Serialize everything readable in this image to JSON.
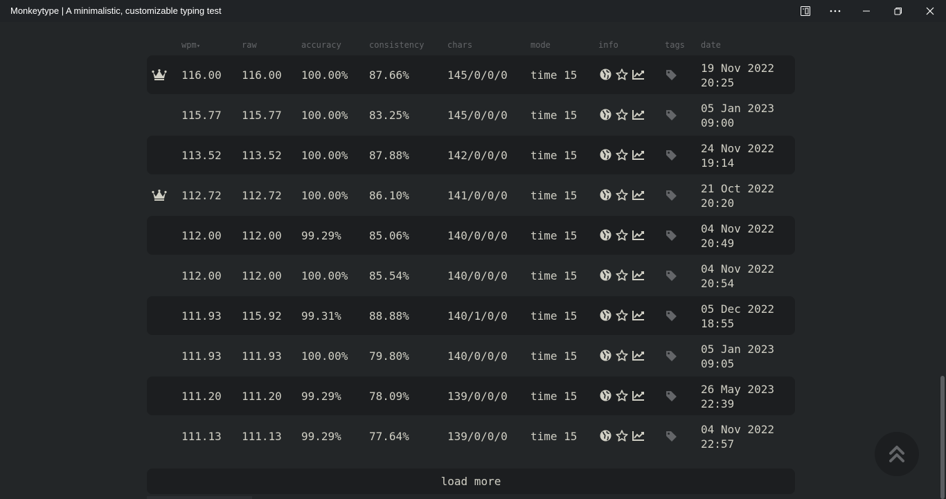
{
  "window": {
    "title": "Monkeytype | A minimalistic, customizable typing test"
  },
  "table": {
    "headers": {
      "wpm": "wpm",
      "raw": "raw",
      "accuracy": "accuracy",
      "consistency": "consistency",
      "chars": "chars",
      "mode": "mode",
      "info": "info",
      "tags": "tags",
      "date": "date"
    },
    "sort_indicator": "▾",
    "rows": [
      {
        "pb": true,
        "wpm": "116.00",
        "raw": "116.00",
        "accuracy": "100.00%",
        "consistency": "87.66%",
        "chars": "145/0/0/0",
        "mode": "time 15",
        "date": "19 Nov 2022",
        "time": "20:25"
      },
      {
        "pb": false,
        "wpm": "115.77",
        "raw": "115.77",
        "accuracy": "100.00%",
        "consistency": "83.25%",
        "chars": "145/0/0/0",
        "mode": "time 15",
        "date": "05 Jan 2023",
        "time": "09:00"
      },
      {
        "pb": false,
        "wpm": "113.52",
        "raw": "113.52",
        "accuracy": "100.00%",
        "consistency": "87.88%",
        "chars": "142/0/0/0",
        "mode": "time 15",
        "date": "24 Nov 2022",
        "time": "19:14"
      },
      {
        "pb": true,
        "wpm": "112.72",
        "raw": "112.72",
        "accuracy": "100.00%",
        "consistency": "86.10%",
        "chars": "141/0/0/0",
        "mode": "time 15",
        "date": "21 Oct 2022",
        "time": "20:20"
      },
      {
        "pb": false,
        "wpm": "112.00",
        "raw": "112.00",
        "accuracy": "99.29%",
        "consistency": "85.06%",
        "chars": "140/0/0/0",
        "mode": "time 15",
        "date": "04 Nov 2022",
        "time": "20:49"
      },
      {
        "pb": false,
        "wpm": "112.00",
        "raw": "112.00",
        "accuracy": "100.00%",
        "consistency": "85.54%",
        "chars": "140/0/0/0",
        "mode": "time 15",
        "date": "04 Nov 2022",
        "time": "20:54"
      },
      {
        "pb": false,
        "wpm": "111.93",
        "raw": "115.92",
        "accuracy": "99.31%",
        "consistency": "88.88%",
        "chars": "140/1/0/0",
        "mode": "time 15",
        "date": "05 Dec 2022",
        "time": "18:55"
      },
      {
        "pb": false,
        "wpm": "111.93",
        "raw": "111.93",
        "accuracy": "100.00%",
        "consistency": "79.80%",
        "chars": "140/0/0/0",
        "mode": "time 15",
        "date": "05 Jan 2023",
        "time": "09:05"
      },
      {
        "pb": false,
        "wpm": "111.20",
        "raw": "111.20",
        "accuracy": "99.29%",
        "consistency": "78.09%",
        "chars": "139/0/0/0",
        "mode": "time 15",
        "date": "26 May 2023",
        "time": "22:39"
      },
      {
        "pb": false,
        "wpm": "111.13",
        "raw": "111.13",
        "accuracy": "99.29%",
        "consistency": "77.64%",
        "chars": "139/0/0/0",
        "mode": "time 15",
        "date": "04 Nov 2022",
        "time": "22:57"
      }
    ]
  },
  "load_more_label": "load more",
  "icons": {
    "pb": "crown-icon",
    "info": [
      "globe-icon",
      "star-icon",
      "chart-line-icon"
    ],
    "tags": "tag-icon",
    "scroll_top": "angles-up-icon",
    "titlebar": [
      "app-menu-icon",
      "more-icon",
      "minimize-icon",
      "restore-icon",
      "close-icon"
    ]
  },
  "colors": {
    "background": "#232628",
    "row_alt": "#1c1e20",
    "text": "#d1d0c5",
    "sub": "#646669"
  }
}
